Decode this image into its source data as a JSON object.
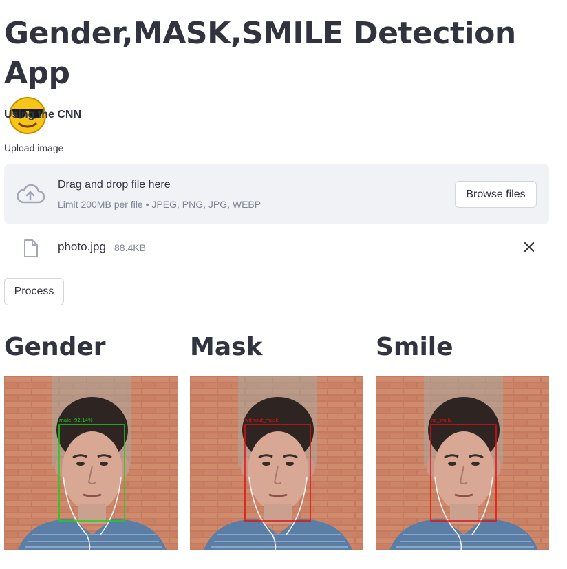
{
  "header": {
    "title": "Gender,MASK,SMILE Detection App",
    "emoji": "sunglasses-face-emoji",
    "subtitle": "Using the CNN"
  },
  "uploader": {
    "label": "Upload image",
    "drop_text": "Drag and drop file here",
    "limit_text": "Limit 200MB per file • JPEG, PNG, JPG, WEBP",
    "browse_label": "Browse files",
    "icon": "cloud-upload-icon"
  },
  "uploaded_file": {
    "name": "photo.jpg",
    "size": "88.4KB",
    "icon": "file-icon",
    "remove_icon": "close-icon"
  },
  "actions": {
    "process_label": "Process"
  },
  "results": [
    {
      "heading": "Gender",
      "box_label": "male: 92.14%",
      "box_color": "#18d218"
    },
    {
      "heading": "Mask",
      "box_label": "without_mask",
      "box_color": "#e01010"
    },
    {
      "heading": "Smile",
      "box_label": "no_smile",
      "box_color": "#e01010"
    }
  ],
  "colors": {
    "text": "#31333f",
    "muted": "#808495",
    "dropzone_bg": "#f0f2f6",
    "border": "#d6d6d9"
  }
}
